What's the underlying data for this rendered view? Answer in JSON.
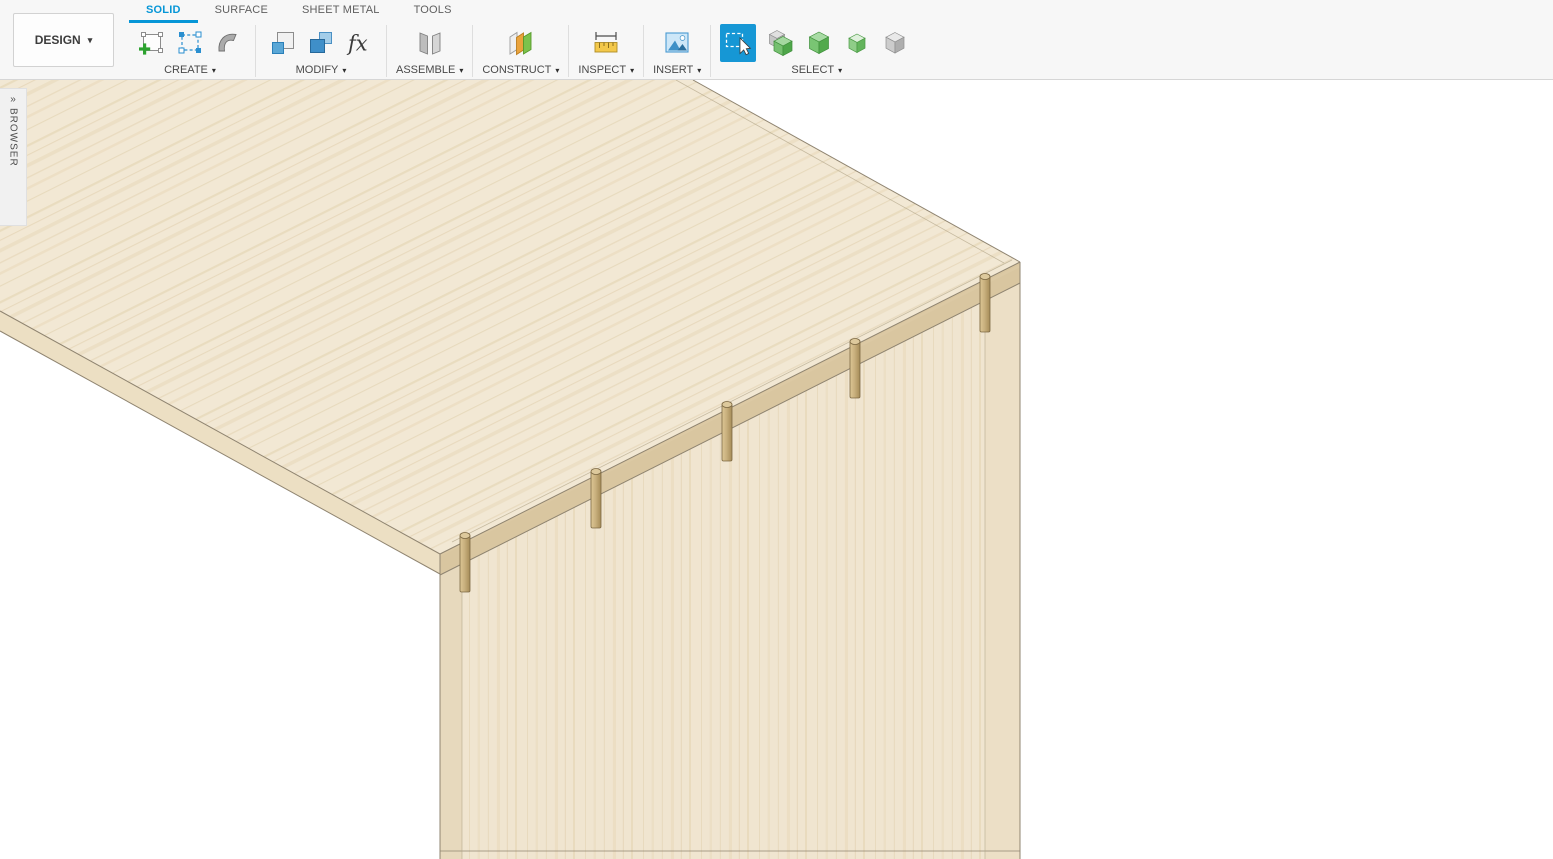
{
  "ribbon": {
    "workspace_selector": {
      "label": "DESIGN"
    },
    "caret": "▾",
    "fx_label": "fx",
    "tabs": [
      {
        "label": "SOLID",
        "active": true
      },
      {
        "label": "SURFACE",
        "active": false
      },
      {
        "label": "SHEET METAL",
        "active": false
      },
      {
        "label": "TOOLS",
        "active": false
      }
    ],
    "groups": [
      {
        "label": "CREATE",
        "icons": [
          "create-sketch-icon",
          "create-form-icon",
          "sweep-icon"
        ]
      },
      {
        "label": "MODIFY",
        "icons": [
          "press-pull-icon",
          "offset-face-icon",
          "change-parameters-fx-icon"
        ]
      },
      {
        "label": "ASSEMBLE",
        "icons": [
          "joint-icon"
        ]
      },
      {
        "label": "CONSTRUCT",
        "icons": [
          "construction-plane-icon"
        ]
      },
      {
        "label": "INSPECT",
        "icons": [
          "measure-icon"
        ]
      },
      {
        "label": "INSERT",
        "icons": [
          "insert-image-icon"
        ]
      },
      {
        "label": "SELECT",
        "icons": [
          "window-select-icon",
          "select-body-icon",
          "select-solid-icon",
          "select-face-icon",
          "select-component-icon"
        ]
      }
    ]
  },
  "browser_panel": {
    "label": "BROWSER",
    "expand_glyph": "»"
  },
  "viewport": {
    "background_color": "#ffffff",
    "model": {
      "description": "Two light plywood panels joined at a corner with five wooden dowel pins along the joint edge",
      "dowel_count": 5,
      "panel_color": "#f2e8d4",
      "edge_color": "#d9c6a0",
      "dowel_color": "#c9b07e"
    }
  }
}
